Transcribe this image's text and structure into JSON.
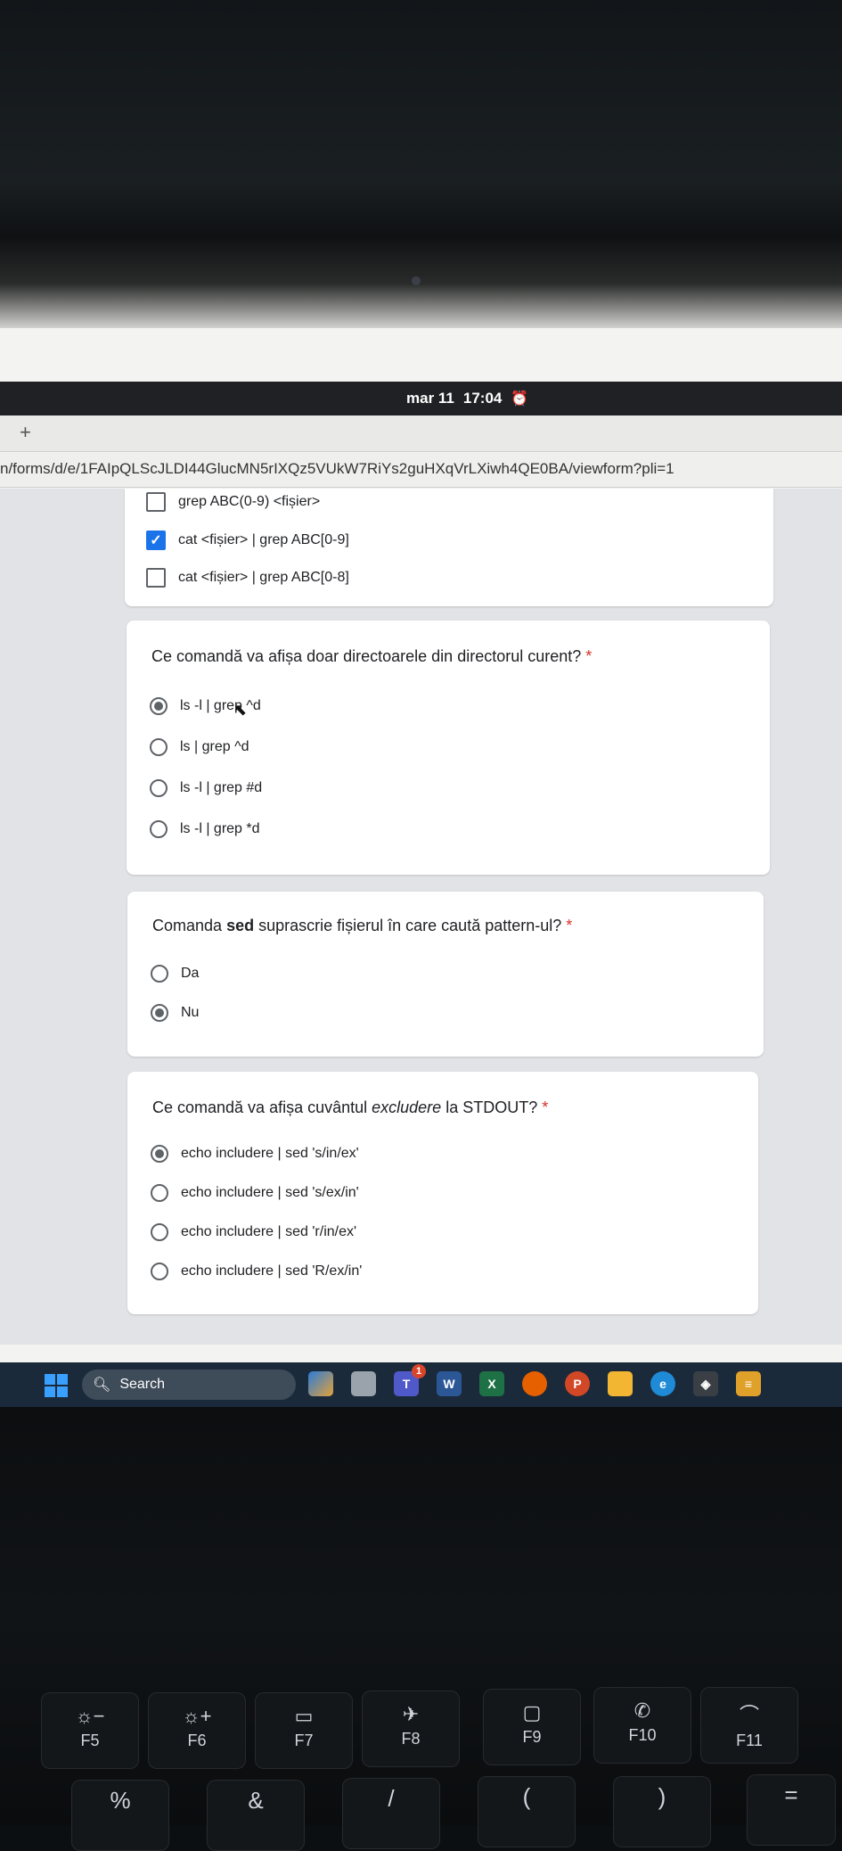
{
  "system": {
    "clock_date": "mar 11",
    "clock_time": "17:04",
    "new_tab": "+"
  },
  "browser": {
    "url": "n/forms/d/e/1FAIpQLScJLDI44GlucMN5rIXQz5VUkW7RiYs2guHXqVrLXiwh4QE0BA/viewform?pli=1"
  },
  "form": {
    "q0": {
      "options": [
        {
          "label": "grep ABC(0-9) <fișier>",
          "checked": false
        },
        {
          "label": "cat <fișier> | grep ABC[0-9]",
          "checked": true
        },
        {
          "label": "cat <fișier> | grep ABC[0-8]",
          "checked": false
        }
      ]
    },
    "q1": {
      "question": "Ce comandă va afișa doar directoarele din directorul curent?",
      "required": "*",
      "options": [
        {
          "label": "ls -l | grep ^d",
          "selected": true
        },
        {
          "label": "ls | grep ^d",
          "selected": false
        },
        {
          "label": "ls -l | grep #d",
          "selected": false
        },
        {
          "label": "ls -l | grep *d",
          "selected": false
        }
      ]
    },
    "q2": {
      "question_pre": "Comanda ",
      "question_bold": "sed",
      "question_post": " suprascrie fișierul în care caută pattern-ul?",
      "required": "*",
      "options": [
        {
          "label": "Da",
          "selected": false
        },
        {
          "label": "Nu",
          "selected": true
        }
      ]
    },
    "q3": {
      "question_pre": "Ce comandă va afișa cuvântul ",
      "question_italic": "excludere",
      "question_post": " la STDOUT?",
      "required": "*",
      "options": [
        {
          "label": "echo includere | sed 's/in/ex'",
          "selected": true
        },
        {
          "label": "echo includere | sed 's/ex/in'",
          "selected": false
        },
        {
          "label": "echo includere | sed 'r/in/ex'",
          "selected": false
        },
        {
          "label": "echo includere | sed 'R/ex/in'",
          "selected": false
        }
      ]
    }
  },
  "taskbar": {
    "search_label": "Search",
    "apps": [
      "copilot-icon",
      "file-icon",
      "teams-icon",
      "word-icon",
      "excel-icon",
      "firefox-icon",
      "powerpoint-icon",
      "folder-icon",
      "edge-icon",
      "package-icon",
      "app-icon"
    ],
    "teams_badge": "1"
  },
  "keyboard": {
    "fkeys": [
      {
        "sym": "☼−",
        "label": "F5"
      },
      {
        "sym": "☼+",
        "label": "F6"
      },
      {
        "sym": "▭",
        "label": "F7"
      },
      {
        "sym": "✈",
        "label": "F8"
      },
      {
        "sym": "▢",
        "label": "F9"
      },
      {
        "sym": "✆",
        "label": "F10"
      },
      {
        "sym": "⌒",
        "label": "F11"
      }
    ],
    "row2": [
      "%",
      "&",
      "/",
      "(",
      ")",
      "="
    ]
  }
}
